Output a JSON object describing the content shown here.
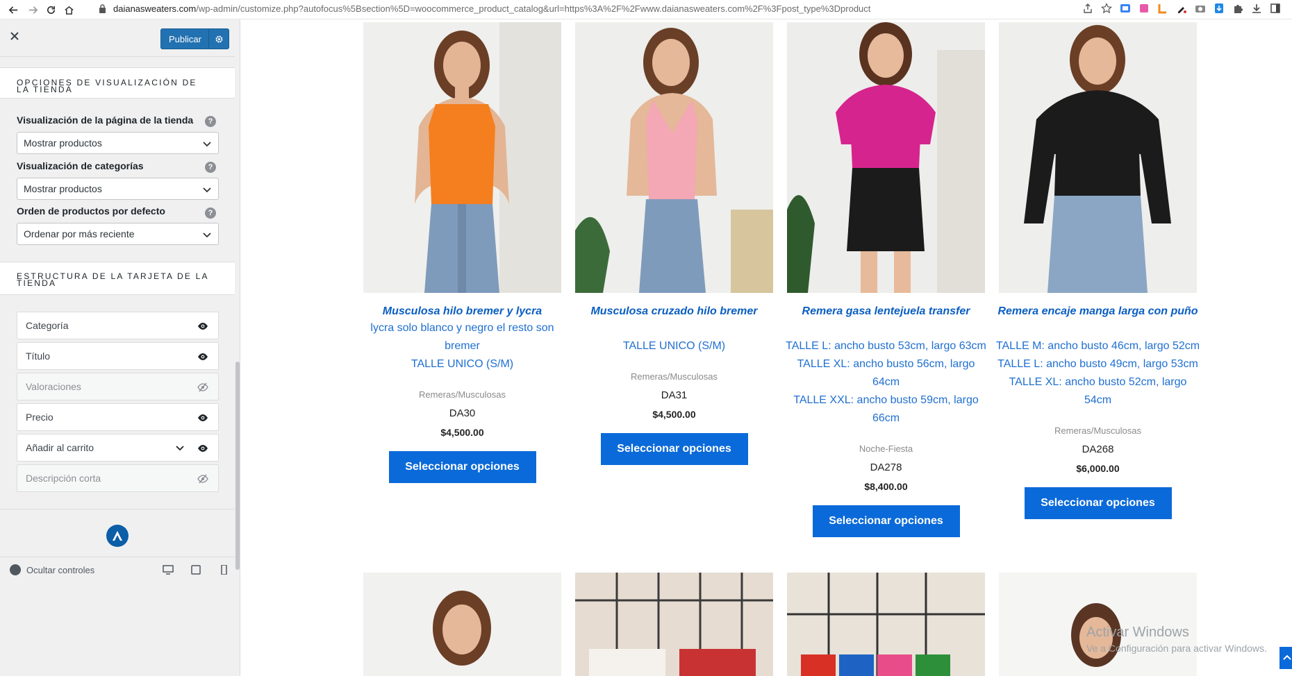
{
  "browser": {
    "url_domain": "daianasweaters.com",
    "url_rest": "/wp-admin/customize.php?autofocus%5Bsection%5D=woocommerce_product_catalog&url=https%3A%2F%2Fwww.daianasweaters.com%2F%3Fpost_type%3Dproduct"
  },
  "sidebar": {
    "publish_label": "Publicar",
    "section1_title": "OPCIONES DE VISUALIZACIÓN DE LA TIENDA",
    "controls": [
      {
        "label": "Visualización de la página de la tienda",
        "value": "Mostrar productos"
      },
      {
        "label": "Visualización de categorías",
        "value": "Mostrar productos"
      },
      {
        "label": "Orden de productos por defecto",
        "value": "Ordenar por más reciente"
      }
    ],
    "help_glyph": "?",
    "section2_title": "ESTRUCTURA DE LA TARJETA DE LA TIENDA",
    "structure_items": [
      {
        "label": "Categoría",
        "visible": true
      },
      {
        "label": "Título",
        "visible": true
      },
      {
        "label": "Valoraciones",
        "visible": false
      },
      {
        "label": "Precio",
        "visible": true
      },
      {
        "label": "Añadir al carrito",
        "visible": true
      },
      {
        "label": "Descripción corta",
        "visible": false
      }
    ],
    "hide_controls_label": "Ocultar controles"
  },
  "products": [
    {
      "title": "Musculosa hilo bremer y lycra",
      "desc": [
        "lycra solo blanco y negro el resto son bremer",
        "TALLE UNICO (S/M)"
      ],
      "category": "Remeras/Musculosas",
      "sku": "DA30",
      "price": "$4,500.00",
      "button": "Seleccionar opciones",
      "garment_color": "#f57f1e"
    },
    {
      "title": "Musculosa cruzado hilo bremer",
      "desc": [
        "",
        "TALLE UNICO (S/M)"
      ],
      "category": "Remeras/Musculosas",
      "sku": "DA31",
      "price": "$4,500.00",
      "button": "Seleccionar opciones",
      "garment_color": "#f4a7b4"
    },
    {
      "title": "Remera gasa lentejuela transfer",
      "desc": [
        "TALLE L: ancho busto 53cm, largo 63cm",
        "TALLE XL: ancho busto 56cm, largo 64cm",
        "TALLE XXL: ancho busto 59cm, largo 66cm"
      ],
      "category": "Noche-Fiesta",
      "sku": "DA278",
      "price": "$8,400.00",
      "button": "Seleccionar opciones",
      "garment_color": "#d6248e"
    },
    {
      "title": "Remera encaje manga larga con puño",
      "desc": [
        "TALLE M: ancho busto 46cm, largo 52cm",
        "TALLE L: ancho busto 49cm, largo 53cm",
        "TALLE XL: ancho busto 52cm, largo 54cm"
      ],
      "category": "Remeras/Musculosas",
      "sku": "DA268",
      "price": "$6,000.00",
      "button": "Seleccionar opciones",
      "garment_color": "#1b1b1b"
    }
  ],
  "watermark": {
    "line1": "Activar Windows",
    "line2": "Ve a Configuración para activar Windows."
  },
  "colors": {
    "accent": "#0b6ad9",
    "wp_blue": "#2271b1",
    "title_blue": "#0a5ec2"
  }
}
